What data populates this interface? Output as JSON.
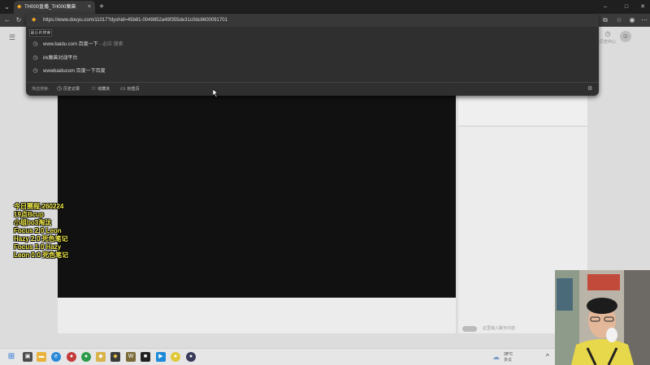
{
  "browser": {
    "tab": {
      "title": "TH000直播_TH000魔兽",
      "close_glyph": "×",
      "icon": "douyu-favicon"
    },
    "new_tab_glyph": "+",
    "window_controls": {
      "minimize": "–",
      "maximize": "□",
      "close": "✕"
    },
    "nav": {
      "back": "←",
      "reload": "↻"
    },
    "toolbar_icons": [
      "extensions-icon",
      "favorites-icon",
      "profile-icon",
      "more-icon"
    ]
  },
  "omnibox": {
    "url": "https://www.douyu.com/11017?dyshid=45b81-0049852a49f355de31c0dc8600091701",
    "tooltip": "最近的搜索",
    "suggestions": [
      {
        "text": "www.baidu.com 百度一下",
        "sub": " - 必应 搜索",
        "icon": "history-icon"
      },
      {
        "text": "irk魔兽对战平台",
        "sub": "",
        "icon": "history-icon"
      },
      {
        "text": "wwwbaiducom 百度一下百度",
        "sub": "",
        "icon": "history-icon"
      }
    ],
    "filter_label": "筛选搜索:",
    "filters": [
      {
        "label": "历史记录",
        "icon": "history-icon"
      },
      {
        "label": "收藏夹",
        "icon": "star-icon"
      },
      {
        "label": "标签页",
        "icon": "tabs-icon"
      }
    ]
  },
  "page": {
    "history_label": "历史中心",
    "chat_placeholder": "这里输入聊天内容"
  },
  "overlay": {
    "lines": [
      "今日赛程-260224",
      "19点Bcup",
      "小组bo3淘汰",
      "Focus 2:0 Leon",
      "Hazy  2:0 死色笔记",
      "Focus 1:0 Hazy",
      "Leon  0:0 死色笔记"
    ]
  },
  "taskbar": {
    "weather_temp": "28°C",
    "weather_desc": "多云",
    "tray_chevron": "^"
  },
  "colors": {
    "overlay_text": "#f4ee4a",
    "video_bg": "#111111",
    "omnibox_bg": "#2f2f2f"
  }
}
